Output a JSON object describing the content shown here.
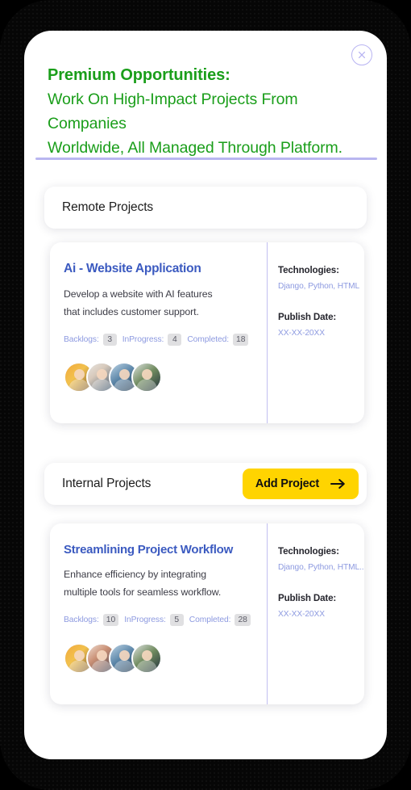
{
  "header": {
    "title_strong": "Premium Opportunities:",
    "title_sub_line1": "Work On High-Impact Projects From Companies",
    "title_sub_line2": "Worldwide, All Managed Through Platform.",
    "title_color": "#1a9e1a",
    "close_icon": "close-circle-icon",
    "divider_color": "#b9b6f0"
  },
  "sections": [
    {
      "title": "Remote Projects",
      "has_action": false
    },
    {
      "title": "Internal Projects",
      "has_action": true,
      "action_label": "Add Project",
      "action_icon": "arrow-right-icon",
      "action_color": "#ffd400"
    }
  ],
  "projects": [
    {
      "title": "Ai - Website Application",
      "title_color": "#3b5ac0",
      "description_line1": "Develop a website with AI features",
      "description_line2": "that includes customer support.",
      "stats": [
        {
          "label": "Backlogs:",
          "value": "3"
        },
        {
          "label": "InProgress:",
          "value": "4"
        },
        {
          "label": "Completed:",
          "value": "18"
        }
      ],
      "technologies_label": "Technologies:",
      "technologies_value": "Django, Python, HTML",
      "publish_date_label": "Publish Date:",
      "publish_date_value": "XX-XX-20XX",
      "avatar_count": 4
    },
    {
      "title": "Streamlining Project Workflow",
      "title_color": "#3b5ac0",
      "description_line1": "Enhance efficiency by integrating",
      "description_line2": "multiple tools for seamless workflow.",
      "stats": [
        {
          "label": "Backlogs:",
          "value": "10"
        },
        {
          "label": "InProgress:",
          "value": "5"
        },
        {
          "label": "Completed:",
          "value": "28"
        }
      ],
      "technologies_label": "Technologies:",
      "technologies_value": "Django, Python, HTML..",
      "publish_date_label": "Publish Date:",
      "publish_date_value": "XX-XX-20XX",
      "avatar_count": 4
    }
  ]
}
